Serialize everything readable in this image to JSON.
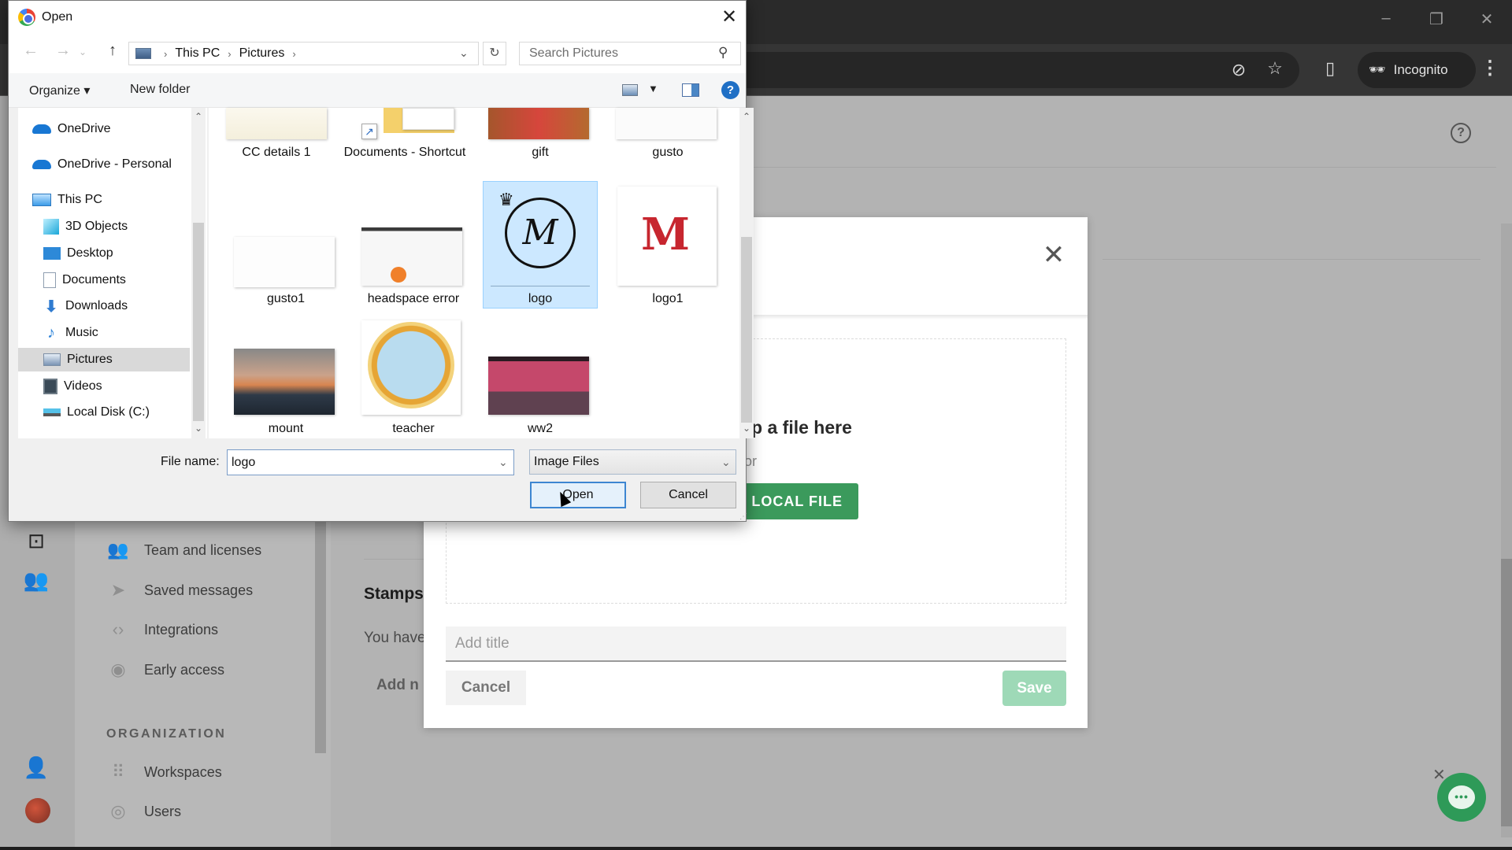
{
  "browser": {
    "window_controls": {
      "minimize": "–",
      "restore": "❐",
      "close": "✕"
    },
    "toolbar_icons": [
      "eye-off-icon",
      "star-icon",
      "side-panel-icon"
    ],
    "incognito_label": "Incognito"
  },
  "app": {
    "rail_icons": [
      "terminal-icon",
      "people-icon",
      "add-person-icon",
      "avatar"
    ],
    "sidebar": {
      "items": [
        {
          "label": "Team and licenses",
          "icon": "people-icon"
        },
        {
          "label": "Saved messages",
          "icon": "send-icon"
        },
        {
          "label": "Integrations",
          "icon": "code-icon"
        },
        {
          "label": "Early access",
          "icon": "eye-icon"
        }
      ],
      "section_heading": "ORGANIZATION",
      "org_items": [
        {
          "label": "Workspaces",
          "icon": "grid-dots-icon"
        },
        {
          "label": "Users",
          "icon": "user-circle-icon"
        }
      ]
    },
    "content": {
      "stamps_title": "Stamps",
      "stamps_desc": "You have",
      "add_new": "Add n"
    },
    "help_icon": "?"
  },
  "upload_modal": {
    "drop_text": "op a file here",
    "or_text": "or",
    "local_file_button": "LOCAL FILE",
    "title_placeholder": "Add title",
    "cancel_label": "Cancel",
    "save_label": "Save"
  },
  "chat_widget": {
    "close": "✕",
    "bubble": "•••"
  },
  "open_dialog": {
    "title": "Open",
    "breadcrumb": [
      "This PC",
      "Pictures"
    ],
    "search_placeholder": "Search Pictures",
    "toolbar": {
      "organize": "Organize ▾",
      "new_folder": "New folder",
      "help": "?"
    },
    "nav_pane": [
      {
        "label": "OneDrive",
        "icon": "cloud"
      },
      {
        "label": "OneDrive - Personal",
        "icon": "cloud"
      },
      {
        "label": "This PC",
        "icon": "pc"
      },
      {
        "label": "3D Objects",
        "icon": "cube"
      },
      {
        "label": "Desktop",
        "icon": "desk"
      },
      {
        "label": "Documents",
        "icon": "doc"
      },
      {
        "label": "Downloads",
        "icon": "down"
      },
      {
        "label": "Music",
        "icon": "music"
      },
      {
        "label": "Pictures",
        "icon": "pic",
        "selected": true
      },
      {
        "label": "Videos",
        "icon": "vid"
      },
      {
        "label": "Local Disk (C:)",
        "icon": "disk"
      }
    ],
    "files": [
      {
        "name": "CC details 1"
      },
      {
        "name": "Documents - Shortcut"
      },
      {
        "name": "gift"
      },
      {
        "name": "gusto"
      },
      {
        "name": "gusto1"
      },
      {
        "name": "headspace error"
      },
      {
        "name": "logo",
        "selected": true
      },
      {
        "name": "logo1"
      },
      {
        "name": "mount"
      },
      {
        "name": "teacher"
      },
      {
        "name": "ww2"
      }
    ],
    "file_name_label": "File name:",
    "file_name_value": "logo",
    "file_type": "Image Files",
    "open_label": "Open",
    "cancel_label": "Cancel"
  }
}
